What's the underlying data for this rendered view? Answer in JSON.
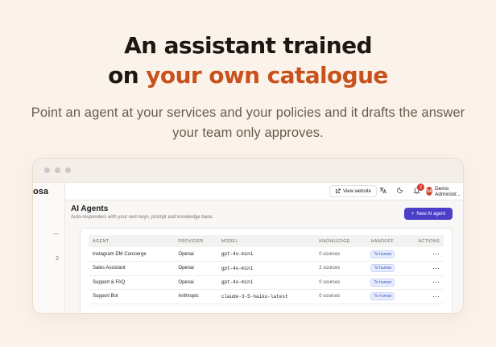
{
  "hero": {
    "title_line1": "An assistant trained",
    "title_line2_prefix": "on ",
    "title_line2_accent": "your own catalogue",
    "subtitle_line1": "Point an agent at your services and your policies and it drafts the answer",
    "subtitle_line2": "your team only approves."
  },
  "sidebar": {
    "brand": "osa",
    "items": [
      "—",
      "2"
    ]
  },
  "topbar": {
    "view_website": "View website",
    "notification_count": "2",
    "user_initials": "DA",
    "user_name": "Demo Administr..."
  },
  "page": {
    "title": "AI Agents",
    "subtitle": "Auto-responders with your own keys, prompt and knowledge base.",
    "new_agent_label": "New AI agent"
  },
  "table": {
    "columns": [
      "AGENT",
      "PROVIDER",
      "MODEL",
      "KNOWLEDGE",
      "HANDOFF",
      "ACTIONS"
    ],
    "rows": [
      {
        "agent": "Instagram DM Concierge",
        "provider": "Openai",
        "model": "gpt-4o-mini",
        "knowledge": "0 sources",
        "handoff": "To human",
        "actions": "⋯"
      },
      {
        "agent": "Sales Assistant",
        "provider": "Openai",
        "model": "gpt-4o-mini",
        "knowledge": "2 sources",
        "handoff": "To human",
        "actions": "⋯"
      },
      {
        "agent": "Support & FAQ",
        "provider": "Openai",
        "model": "gpt-4o-mini",
        "knowledge": "0 sources",
        "handoff": "To human",
        "actions": "⋯"
      },
      {
        "agent": "Support Bot",
        "provider": "Anthropic",
        "model": "claude-3-5-haiku-latest",
        "knowledge": "0 sources",
        "handoff": "To human",
        "actions": "⋯"
      }
    ]
  },
  "colors": {
    "accent": "#c8511d",
    "primary_button": "#4b3fc9",
    "background": "#fbf3ea"
  }
}
